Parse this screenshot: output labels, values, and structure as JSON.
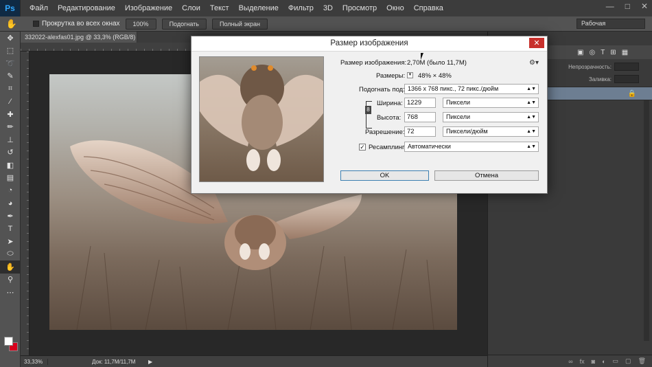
{
  "app": {
    "logo": "Ps",
    "menu": [
      "Файл",
      "Редактирование",
      "Изображение",
      "Слои",
      "Текст",
      "Выделение",
      "Фильтр",
      "3D",
      "Просмотр",
      "Окно",
      "Справка"
    ],
    "window_controls": [
      "—",
      "□",
      "✕"
    ]
  },
  "options": {
    "scroll_all_windows": "Прокрутка во всех окнах",
    "btn_100": "100%",
    "btn_fit": "Подогнать",
    "btn_fullscreen": "Полный экран",
    "workspace": "Рабочая"
  },
  "document": {
    "tab": "332022-alexfas01.jpg @ 33,3% (RGB/8) *",
    "zoom": "33,33%",
    "doc_info": "Док: 11,7M/11,7M"
  },
  "layers_panel": {
    "opacity_label": "Непрозрачность:",
    "fill_label": "Заливка:"
  },
  "dialog": {
    "title": "Размер изображения",
    "image_size_label": "Размер изображения:",
    "image_size_value": "2,70M (было 11,7M)",
    "dimensions_label": "Размеры:",
    "dimensions_value": "48%  ×  48%",
    "fit_to_label": "Подогнать под:",
    "fit_to_value": "1366 x 768 пикс., 72 пикс./дюйм",
    "width_label": "Ширина:",
    "width_value": "1229",
    "width_unit": "Пиксели",
    "height_label": "Высота:",
    "height_value": "768",
    "height_unit": "Пиксели",
    "resolution_label": "Разрешение:",
    "resolution_value": "72",
    "resolution_unit": "Пиксели/дюйм",
    "resample_label": "Ресамплинг:",
    "resample_value": "Автоматически",
    "resample_checked": true,
    "ok_label": "OK",
    "cancel_label": "Отмена"
  },
  "colors": {
    "foreground": "#ffffff",
    "background": "#d6001c",
    "close_button": "#c8302c"
  }
}
